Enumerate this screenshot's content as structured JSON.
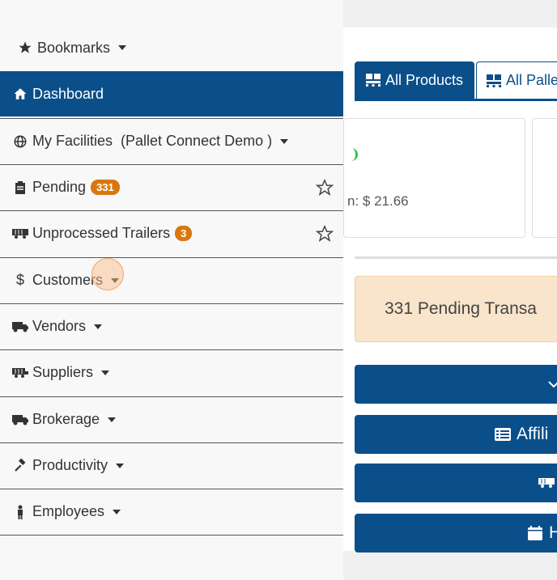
{
  "sidebar": {
    "bookmarks": {
      "label": "Bookmarks",
      "icon": "star-icon"
    },
    "items": [
      {
        "label": "Dashboard",
        "icon": "home-icon",
        "active": true
      },
      {
        "label": "My Facilities  (Pallet Connect Demo )",
        "icon": "globe-icon",
        "dropdown": true
      },
      {
        "label": "Pending",
        "icon": "clipboard-icon",
        "badge": "331",
        "starred": false
      },
      {
        "label": "Unprocessed Trailers",
        "icon": "trailer-icon",
        "badge": "3",
        "starred": false
      },
      {
        "label": "Customers",
        "icon": "dollar-icon",
        "dropdown": true
      },
      {
        "label": "Vendors",
        "icon": "truck-icon",
        "dropdown": true
      },
      {
        "label": "Suppliers",
        "icon": "trailer-icon",
        "dropdown": true
      },
      {
        "label": "Brokerage",
        "icon": "truck-icon",
        "dropdown": true
      },
      {
        "label": "Productivity",
        "icon": "hammer-icon",
        "dropdown": true
      },
      {
        "label": "Employees",
        "icon": "person-icon",
        "dropdown": true
      }
    ]
  },
  "main": {
    "tabs": [
      {
        "label": "All Products",
        "icon": "pallet-icon",
        "active": true
      },
      {
        "label": "All Palle",
        "icon": "pallet-icon",
        "active": false
      }
    ],
    "card_value": "n: $ 21.66",
    "pending_alert": "331 Pending Transa",
    "buttons": [
      {
        "label": "",
        "icon": "chevron-icon"
      },
      {
        "label": "Affili",
        "icon": "list-icon"
      },
      {
        "label": "",
        "icon": "trailer-icon"
      },
      {
        "label": "H",
        "icon": "calendar-icon"
      }
    ]
  },
  "colors": {
    "primary": "#0a4f8a",
    "badge": "#d9770f",
    "alert_bg": "#f9e4cc"
  }
}
